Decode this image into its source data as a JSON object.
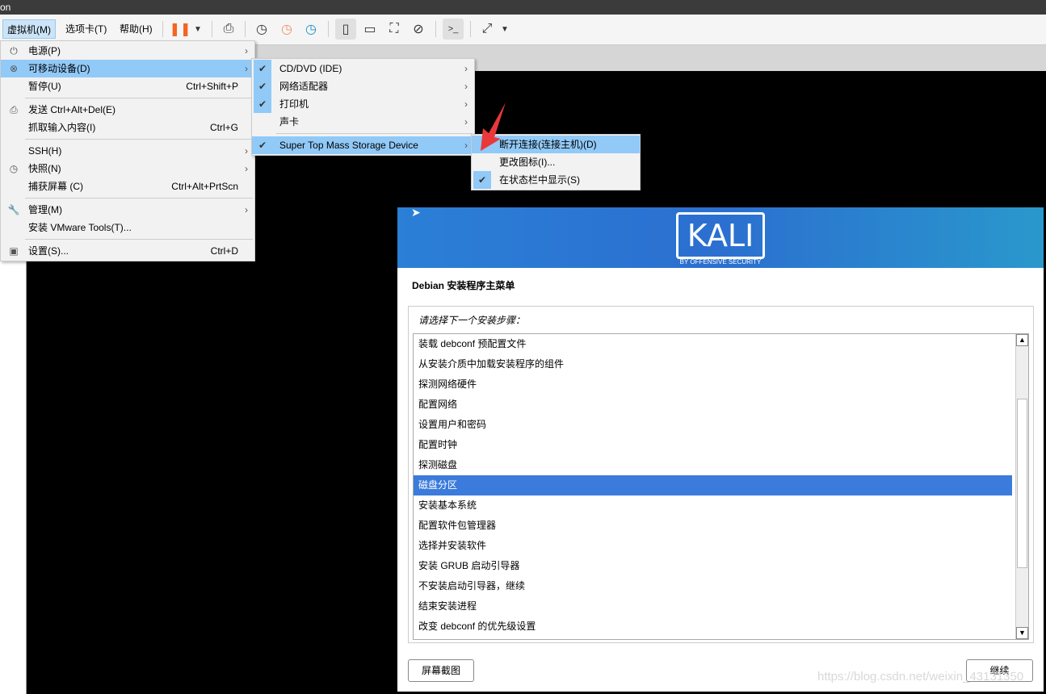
{
  "title": "on",
  "menubar": [
    "虚拟机(M)",
    "选项卡(T)",
    "帮助(H)"
  ],
  "vm_menu": [
    {
      "icon": "power-icon",
      "label": "电源(P)",
      "arrow": true
    },
    {
      "icon": "removable-device-icon",
      "label": "可移动设备(D)",
      "arrow": true,
      "highlight": true
    },
    {
      "label": "暂停(U)",
      "shortcut": "Ctrl+Shift+P"
    },
    {
      "sep": true
    },
    {
      "icon": "send-keys-icon",
      "label": "发送 Ctrl+Alt+Del(E)"
    },
    {
      "label": "抓取输入内容(I)",
      "shortcut": "Ctrl+G"
    },
    {
      "sep": true
    },
    {
      "label": "SSH(H)",
      "arrow": true
    },
    {
      "icon": "snapshot-icon",
      "label": "快照(N)",
      "arrow": true
    },
    {
      "label": "捕获屏幕 (C)",
      "shortcut": "Ctrl+Alt+PrtScn"
    },
    {
      "sep": true
    },
    {
      "icon": "wrench-icon",
      "label": "管理(M)",
      "arrow": true
    },
    {
      "label": "安装 VMware Tools(T)..."
    },
    {
      "sep": true
    },
    {
      "icon": "settings-icon",
      "label": "设置(S)...",
      "shortcut": "Ctrl+D"
    }
  ],
  "devices_menu": [
    {
      "label": "CD/DVD (IDE)",
      "checked": true
    },
    {
      "label": "网络适配器",
      "checked": true
    },
    {
      "label": "打印机",
      "checked": true
    },
    {
      "label": "声卡",
      "checked": false
    },
    {
      "sep": true
    },
    {
      "label": "Super Top Mass Storage Device",
      "checked": true,
      "highlight": true
    }
  ],
  "usb_menu": [
    {
      "label": "断开连接(连接主机)(D)",
      "highlight": true
    },
    {
      "label": "更改图标(I)..."
    },
    {
      "label": "在状态栏中显示(S)",
      "checked": true
    }
  ],
  "installer": {
    "logo": "KALI",
    "logo_sub": "BY OFFENSIVE SECURITY",
    "title": "Debian 安装程序主菜单",
    "prompt": "请选择下一个安装步骤：",
    "selected_index": 7,
    "items": [
      "装载 debconf 预配置文件",
      "从安装介质中加载安装程序的组件",
      "探测网络硬件",
      "配置网络",
      "设置用户和密码",
      "配置时钟",
      "探测磁盘",
      "磁盘分区",
      "安装基本系统",
      "配置软件包管理器",
      "选择并安装软件",
      "安装 GRUB 启动引导器",
      "不安装启动引导器，继续",
      "结束安装进程",
      "改变 debconf 的优先级设置"
    ],
    "screenshot_button": "屏幕截图",
    "continue_button": "继续"
  },
  "watermark": "https://blog.csdn.net/weixin_43131350",
  "colors": {
    "highlight": "#91c9f7",
    "selection": "#3b7bdc",
    "pause": "#f26522"
  }
}
